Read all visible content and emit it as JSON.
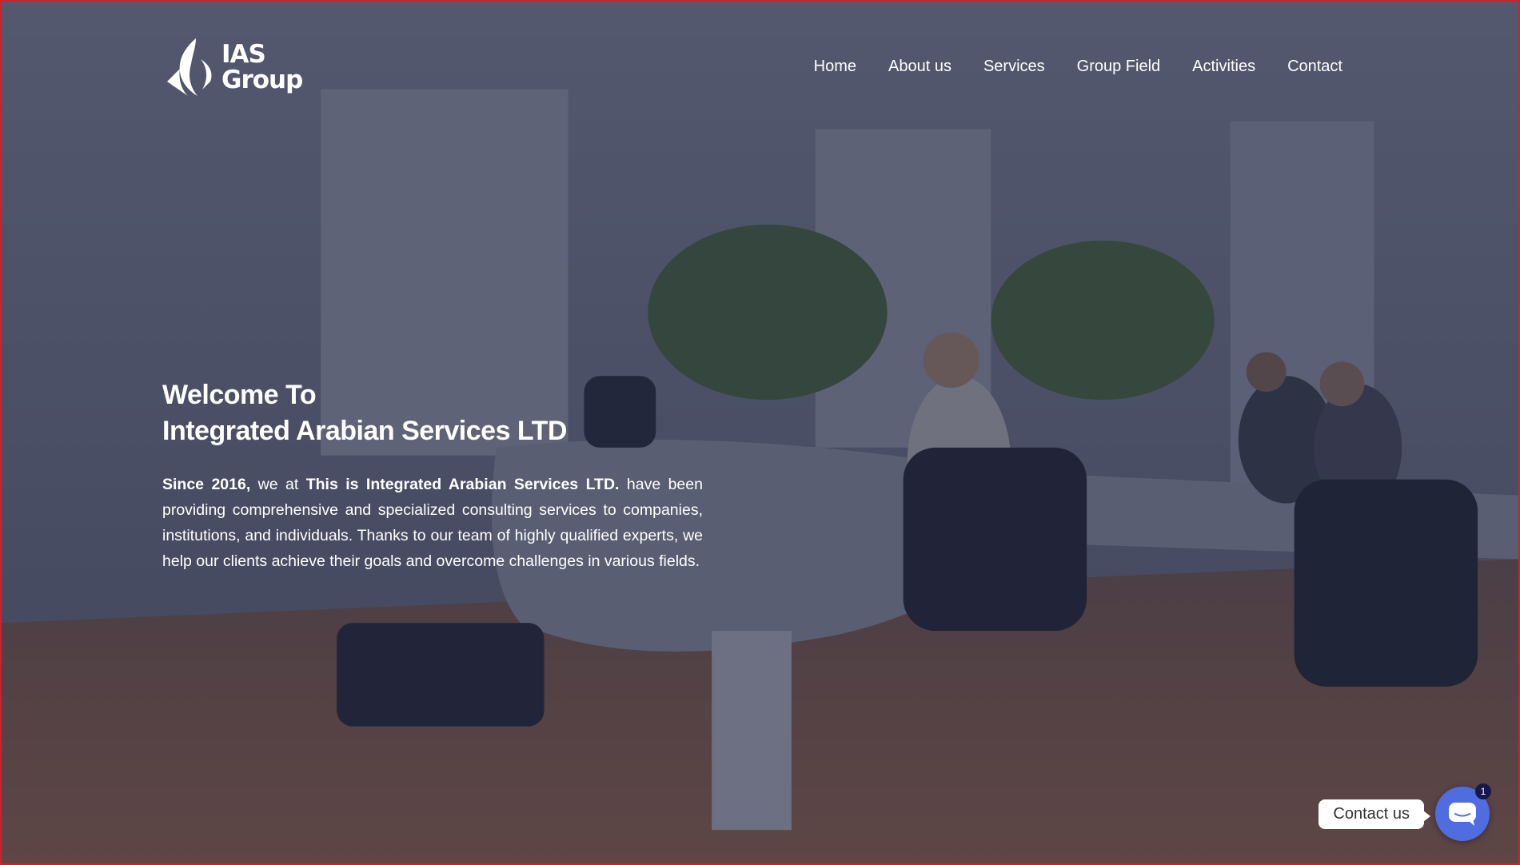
{
  "header": {
    "logo_line1": "IAS",
    "logo_line2": "Group",
    "nav": [
      "Home",
      "About us",
      "Services",
      "Group Field",
      "Activities",
      "Contact"
    ]
  },
  "hero": {
    "title_line1": "Welcome To",
    "title_line2": "Integrated Arabian Services LTD",
    "text_bold1": "Since 2016,",
    "text_part1": " we at ",
    "text_bold2": "This is Integrated Arabian Services LTD.",
    "text_part2": " have been providing comprehensive and specialized consulting services to companies, institutions, and individuals. Thanks to our team of highly qualified experts, we help our clients achieve their goals and overcome challenges in various fields."
  },
  "widget": {
    "contact_label": "Contact us",
    "badge_count": "1"
  },
  "colors": {
    "border": "#d21f2a",
    "overlay": "#242842",
    "chat_button": "#4f6de0"
  },
  "icons": {
    "logo": "ias-logo-mark",
    "chat": "chat-bubble-icon"
  }
}
